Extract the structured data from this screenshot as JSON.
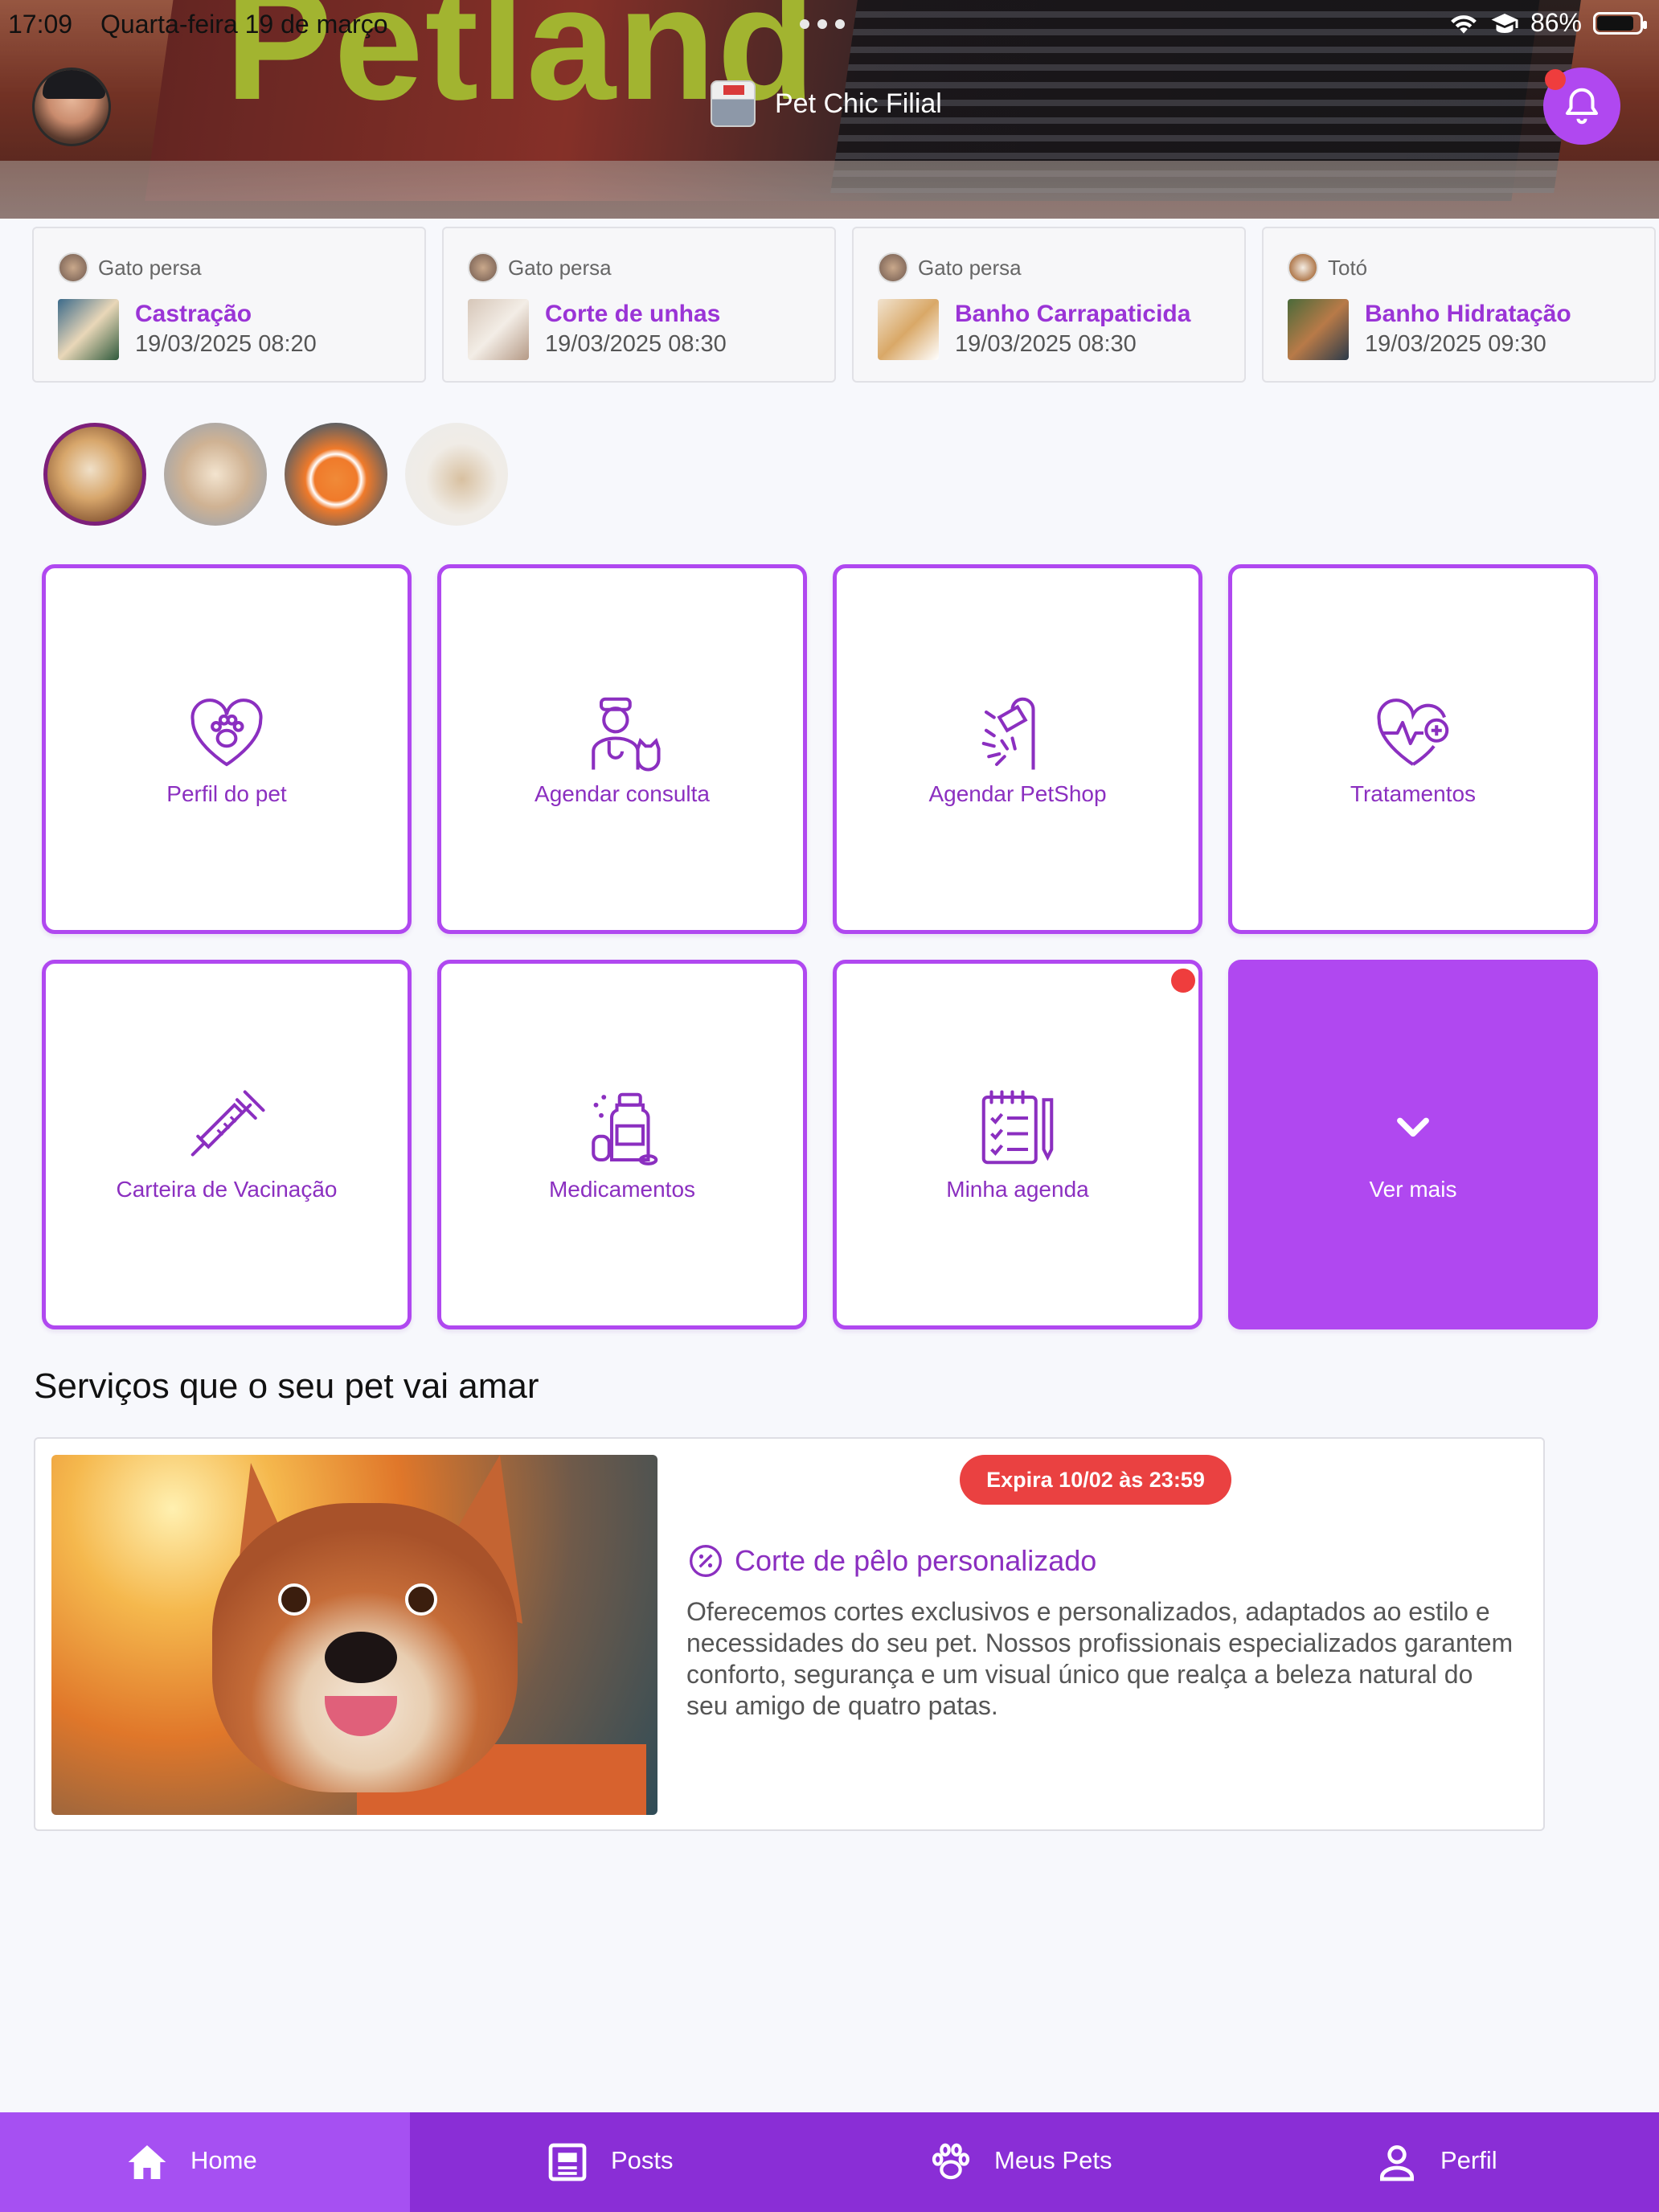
{
  "status_bar": {
    "time": "17:09",
    "date": "Quarta-feira 19 de março",
    "battery": "86%",
    "battery_level": 0.86
  },
  "header": {
    "store_name": "Pet Chic Filial",
    "hero_sign": "Petland"
  },
  "appointments": [
    {
      "pet": "Gato persa",
      "service": "Castração",
      "datetime": "19/03/2025 08:20"
    },
    {
      "pet": "Gato persa",
      "service": "Corte de unhas",
      "datetime": "19/03/2025 08:30"
    },
    {
      "pet": "Gato persa",
      "service": "Banho Carrapaticida",
      "datetime": "19/03/2025 08:30"
    },
    {
      "pet": "Totó",
      "service": "Banho Hidratação",
      "datetime": "19/03/2025 09:30"
    }
  ],
  "menu": {
    "tiles": [
      {
        "label": "Perfil do pet",
        "icon": "heart-paw-icon"
      },
      {
        "label": "Agendar consulta",
        "icon": "vet-doctor-icon"
      },
      {
        "label": "Agendar PetShop",
        "icon": "shower-icon"
      },
      {
        "label": "Tratamentos",
        "icon": "heart-pulse-plus-icon"
      },
      {
        "label": "Carteira de Vacinação",
        "icon": "syringe-icon"
      },
      {
        "label": "Medicamentos",
        "icon": "medicine-bottle-icon"
      },
      {
        "label": "Minha agenda",
        "icon": "checklist-icon"
      },
      {
        "label": "Ver mais",
        "icon": "chevron-down-icon"
      }
    ]
  },
  "services": {
    "section_title": "Serviços que o seu pet vai amar",
    "card": {
      "badge": "Expira 10/02 às 23:59",
      "title": "Corte de pêlo personalizado",
      "description": "Oferecemos cortes exclusivos e personalizados, adaptados ao estilo e necessidades do seu pet. Nossos profissionais especializados garantem conforto, segurança e um visual único que realça a beleza natural do seu amigo de quatro patas."
    }
  },
  "bottom_nav": {
    "items": [
      {
        "label": "Home",
        "icon": "home-icon",
        "active": true
      },
      {
        "label": "Posts",
        "icon": "posts-icon"
      },
      {
        "label": "Meus Pets",
        "icon": "paw-icon"
      },
      {
        "label": "Perfil",
        "icon": "person-icon"
      }
    ]
  },
  "colors": {
    "accent": "#b048f0",
    "accent_dark": "#8a2ed6",
    "alert": "#ea4141",
    "text_purple": "#8b2fc0"
  }
}
